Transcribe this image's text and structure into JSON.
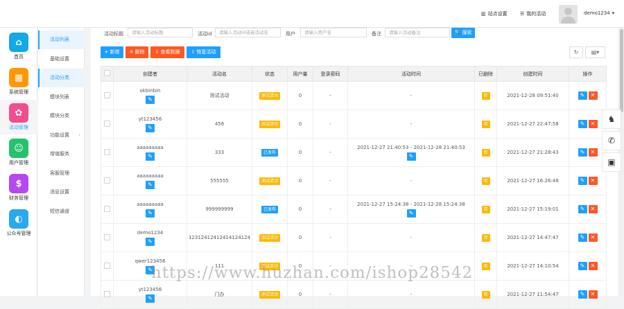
{
  "header": {
    "site_settings": "站点设置",
    "my_activities": "我的活动",
    "username": "demo1234",
    "dropdown_arrow": "▾"
  },
  "sidebar_primary": [
    {
      "label": "首页",
      "icon": "home-icon",
      "glyph": "⌂",
      "color": "#11a9e6"
    },
    {
      "label": "系统管理",
      "icon": "grid-icon",
      "glyph": "▦",
      "color": "#ff9800"
    },
    {
      "label": "活动管理",
      "icon": "gear-icon",
      "glyph": "✿",
      "color": "#f44c8d"
    },
    {
      "label": "用户管理",
      "icon": "user-icon",
      "glyph": "☺",
      "color": "#22c36a"
    },
    {
      "label": "财务管理",
      "icon": "money-icon",
      "glyph": "$",
      "color": "#b548f0"
    },
    {
      "label": "公众号管理",
      "icon": "wechat-icon",
      "glyph": "◐",
      "color": "#28a9ec"
    }
  ],
  "sidebar_secondary": [
    {
      "label": "活动列表"
    },
    {
      "label": "基础设置"
    },
    {
      "label": "活动分类"
    },
    {
      "label": "模块列表"
    },
    {
      "label": "模块分类"
    },
    {
      "label": "功能设置",
      "arrow": "›"
    },
    {
      "label": "增值服务"
    },
    {
      "label": "客服管理"
    },
    {
      "label": "消息设置"
    },
    {
      "label": "短信通道"
    }
  ],
  "filters": {
    "title_label": "活动标题",
    "title_placeholder": "请输入活动标题",
    "id_label": "活动id",
    "id_placeholder": "请输入活动id或者活动名",
    "user_label": "用户",
    "user_placeholder": "请输入用户名",
    "remark_label": "备注",
    "remark_placeholder": "请输入活动备注",
    "search_button": "🔍 搜索"
  },
  "toolbar": {
    "add": "+ 新增",
    "delete": "✕ 删除",
    "export": "⇩ 查看数据",
    "restore": "⇩ 恢复活动",
    "refresh": "↻",
    "columns": "▤▾"
  },
  "table": {
    "headers": [
      "",
      "创建者",
      "活动名",
      "状态",
      "用户量",
      "登录密码",
      "活动时间",
      "已删除",
      "创建时间",
      "操作"
    ],
    "rows": [
      {
        "creator": "okbinbin",
        "name": "测试活动",
        "status": "测试活动",
        "status_type": "o",
        "users": "0",
        "password": "-",
        "time": "-",
        "time_edit": false,
        "deleted": "否",
        "created": "2021-12-28 09:51:40"
      },
      {
        "creator": "yt123456",
        "name": "456",
        "status": "测试活动",
        "status_type": "o",
        "users": "0",
        "password": "-",
        "time": "-",
        "time_edit": false,
        "deleted": "否",
        "created": "2021-12-27 22:47:58"
      },
      {
        "creator": "aaaaaaaaa",
        "name": "333",
        "status": "已发布",
        "status_type": "b",
        "users": "0",
        "password": "-",
        "time": "2021-12-27 21:40:53 - 2021-12-28 21:40:53",
        "time_edit": true,
        "deleted": "否",
        "created": "2021-12-27 21:28:43"
      },
      {
        "creator": "aaaaaaaaa",
        "name": "555555",
        "status": "测试活动",
        "status_type": "o",
        "users": "0",
        "password": "-",
        "time": "-",
        "time_edit": false,
        "deleted": "否",
        "created": "2021-12-27 16:26:48"
      },
      {
        "creator": "aaaaaaaaa",
        "name": "999999999",
        "status": "已发布",
        "status_type": "b",
        "users": "0",
        "password": "-",
        "time": "2021-12-27 15:24:38 - 2021-12-28 15:24:38",
        "time_edit": true,
        "deleted": "否",
        "created": "2021-12-27 15:19:01"
      },
      {
        "creator": "demo1234",
        "name": "12312412412414124124",
        "status": "测试活动",
        "status_type": "o",
        "users": "0",
        "password": "-",
        "time": "-",
        "time_edit": false,
        "deleted": "否",
        "created": "2021-12-27 14:47:47"
      },
      {
        "creator": "qwer123456",
        "name": "111",
        "status": "测试活动",
        "status_type": "o",
        "users": "0",
        "password": "-",
        "time": "-",
        "time_edit": false,
        "deleted": "否",
        "created": "2021-12-27 14:10:54"
      },
      {
        "creator": "yt123456",
        "name": "门办",
        "status": "测试活动",
        "status_type": "o",
        "users": "0",
        "password": "-",
        "time": "-",
        "time_edit": false,
        "deleted": "否",
        "created": "2021-12-27 11:54:47"
      }
    ],
    "edit_glyph": "✎",
    "delete_glyph": "✕"
  },
  "float_tools": [
    {
      "icon": "qq-icon",
      "glyph": "♞"
    },
    {
      "icon": "phone-icon",
      "glyph": "✆"
    },
    {
      "icon": "qrcode-icon",
      "glyph": "▣"
    }
  ],
  "watermark": "https://www.huzhan.com/ishop28542"
}
